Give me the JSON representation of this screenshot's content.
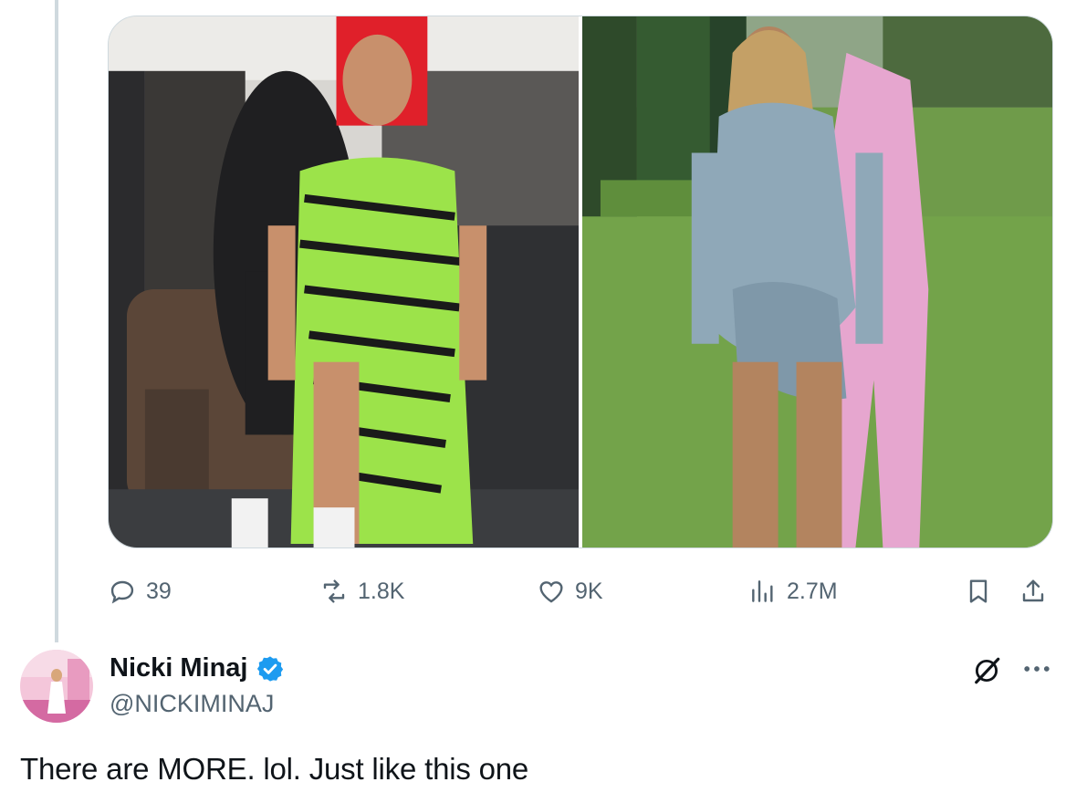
{
  "media": {
    "images": [
      {
        "alt": "Woman in green and black zebra print dress standing in front of a man, in a tour bus lounge"
      },
      {
        "alt": "Woman in a draped blue-grey blazer dress standing on a lawn, man in pink suit behind her"
      }
    ]
  },
  "actions": {
    "reply_count": "39",
    "repost_count": "1.8K",
    "like_count": "9K",
    "view_count": "2.7M"
  },
  "post": {
    "display_name": "Nicki Minaj",
    "handle": "@NICKIMINAJ",
    "text": "There are MORE. lol. Just like this one"
  },
  "colors": {
    "accent": "#1d9bf0",
    "muted": "#536471",
    "text": "#0f1419",
    "border": "#cfd9de"
  },
  "icons": [
    "reply-icon",
    "repost-icon",
    "like-icon",
    "views-icon",
    "bookmark-icon",
    "share-icon",
    "verified-badge-icon",
    "grok-icon",
    "more-icon"
  ]
}
